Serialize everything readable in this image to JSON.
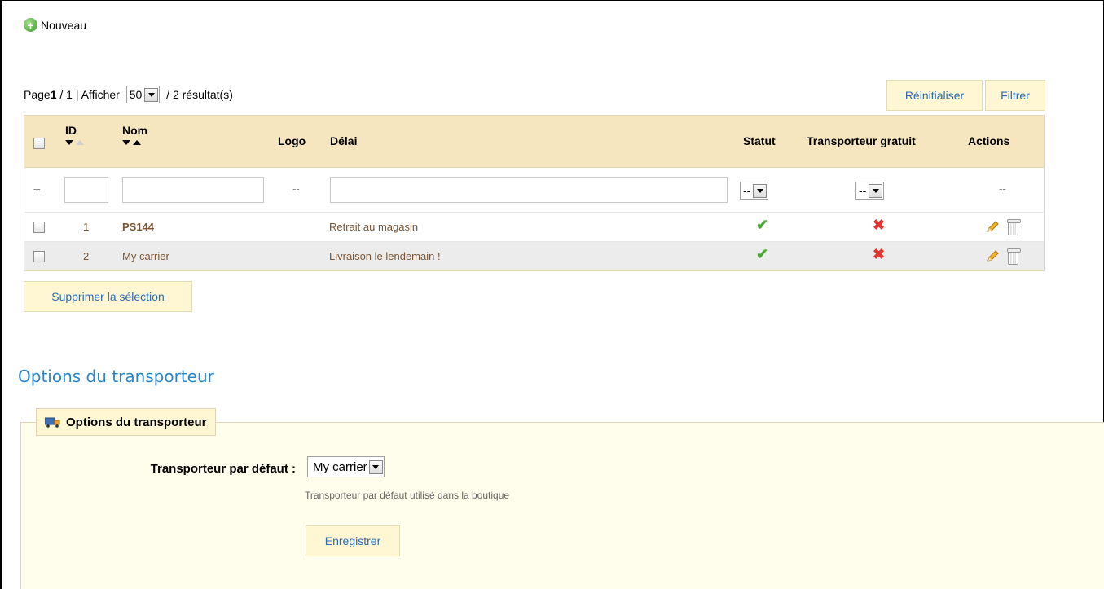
{
  "toolbar": {
    "new_label": "Nouveau"
  },
  "pager": {
    "page_prefix": "Page ",
    "page_current": "1",
    "page_total": " / 1 | Afficher ",
    "per_page": "50",
    "results": " / 2 résultat(s)"
  },
  "buttons": {
    "reset": "Réinitialiser",
    "filter": "Filtrer",
    "delete_selection": "Supprimer la sélection",
    "save": "Enregistrer"
  },
  "table": {
    "headers": {
      "id": "ID",
      "name": "Nom",
      "logo": "Logo",
      "delay": "Délai",
      "status": "Statut",
      "free": "Transporteur gratuit",
      "actions": "Actions"
    },
    "filters": {
      "dash": "--",
      "status_value": "--",
      "free_value": "--"
    },
    "rows": [
      {
        "id": "1",
        "name": "PS144",
        "delay": "Retrait au magasin",
        "status": "enabled",
        "free": "no"
      },
      {
        "id": "2",
        "name": "My carrier",
        "delay": "Livraison le lendemain !",
        "status": "enabled",
        "free": "no"
      }
    ]
  },
  "options": {
    "section_title": "Options du transporteur",
    "legend": "Options du transporteur",
    "default_carrier_label": "Transporteur par défaut :",
    "default_carrier_value": "My carrier",
    "hint": "Transporteur par défaut utilisé dans la boutique"
  },
  "icons": {
    "status_enabled": "check-icon",
    "free_no": "cross-icon",
    "edit": "pencil-icon",
    "delete": "trash-icon"
  },
  "colors": {
    "header_bg": "#f5e6bf",
    "button_bg": "#fff6d3",
    "link_blue": "#2a6db5",
    "section_blue": "#2a86c9",
    "fieldset_bg": "#fffdeb"
  }
}
